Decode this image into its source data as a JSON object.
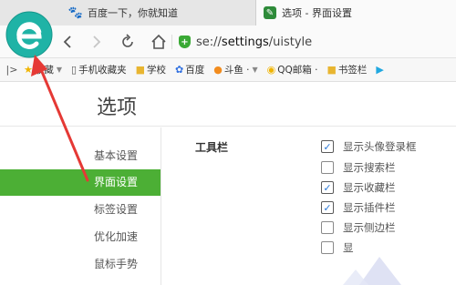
{
  "tabs": [
    {
      "icon": "baidu-paw-icon",
      "title": "百度一下，你就知道"
    },
    {
      "icon": "settings-wrench-icon",
      "title": "选项 - 界面设置"
    }
  ],
  "nav": {
    "back": "‹",
    "forward": "›",
    "refresh": "↻",
    "home": "⌂"
  },
  "address": {
    "prefix": "se://",
    "path": "settings",
    "suffix": "/uistyle"
  },
  "bookmarks": {
    "toggle": "|>",
    "items": [
      {
        "icon": "star-icon",
        "label": "收藏",
        "caret": true
      },
      {
        "icon": "phone-icon",
        "label": "手机收藏夹",
        "caret": false
      },
      {
        "icon": "folder-icon",
        "label": "学校",
        "caret": false
      },
      {
        "icon": "baidu-paw-icon",
        "label": "百度",
        "caret": false
      },
      {
        "icon": "douyu-icon",
        "label": "斗鱼 ·",
        "caret": true
      },
      {
        "icon": "qq-mail-icon",
        "label": "QQ邮箱 ·",
        "caret": false
      },
      {
        "icon": "folder-icon",
        "label": "书签栏",
        "caret": false
      },
      {
        "icon": "bilibili-icon",
        "label": "",
        "caret": false
      }
    ]
  },
  "page": {
    "title": "选项",
    "sidebar": [
      "基本设置",
      "界面设置",
      "标签设置",
      "优化加速",
      "鼠标手势"
    ],
    "active_index": 1,
    "section_label": "工具栏",
    "options": [
      {
        "label": "显示头像登录框",
        "checked": true
      },
      {
        "label": "显示搜索栏",
        "checked": false
      },
      {
        "label": "显示收藏栏",
        "checked": true
      },
      {
        "label": "显示插件栏",
        "checked": true
      },
      {
        "label": "显示侧边栏",
        "checked": false
      },
      {
        "label": "显",
        "checked": false
      }
    ]
  },
  "colors": {
    "accent_green": "#4caf35",
    "arrow_red": "#e53935",
    "logo_teal": "#1fb3a6"
  }
}
